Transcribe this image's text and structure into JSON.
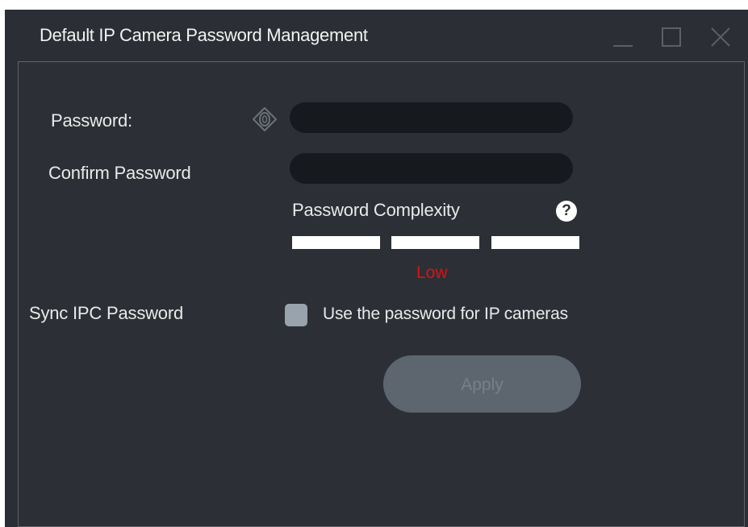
{
  "window": {
    "title": "Default IP Camera Password Management",
    "controls": [
      "minimize-icon",
      "maximize-icon",
      "close-icon"
    ]
  },
  "form": {
    "password_label": "Password:",
    "password_value": "",
    "confirm_label": "Confirm Password",
    "confirm_value": "",
    "complexity_label": "Password Complexity",
    "help_glyph": "?",
    "strength_text": "Low",
    "strength_bars_total": 3,
    "sync_label": "Sync IPC Password",
    "sync_checkbox_label": "Use the password for IP cameras",
    "sync_checked": false,
    "apply_label": "Apply"
  },
  "colors": {
    "window_bg": "#2b2f35",
    "field_bg": "#16191e",
    "strength_low": "#e01010",
    "checkbox": "#98a3ad",
    "apply_disabled_bg": "#5d666f",
    "apply_disabled_text": "#778089"
  }
}
